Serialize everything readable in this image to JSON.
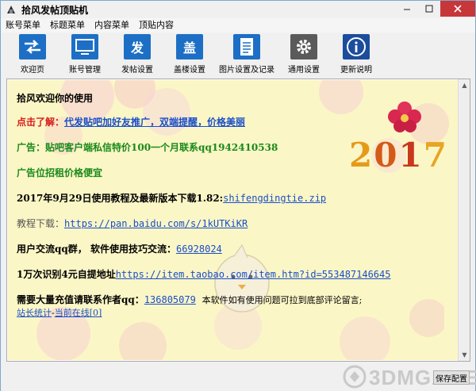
{
  "window": {
    "title": "拾风发帖顶贴机"
  },
  "menubar": {
    "items": [
      "账号菜单",
      "标题菜单",
      "内容菜单",
      "顶贴内容"
    ]
  },
  "toolbar": {
    "items": [
      {
        "label": "欢迎页",
        "icon": "arrows-icon",
        "glyph": "⇆",
        "color": "#1c6fc5"
      },
      {
        "label": "账号管理",
        "icon": "monitor-icon",
        "glyph": "",
        "color": "#1c6fc5"
      },
      {
        "label": "发帖设置",
        "icon": "fa-char-icon",
        "glyph": "发",
        "color": "#1c6fc5"
      },
      {
        "label": "盖楼设置",
        "icon": "gai-char-icon",
        "glyph": "盖",
        "color": "#1c6fc5"
      },
      {
        "label": "图片设置及记录",
        "icon": "document-icon",
        "glyph": "",
        "color": "#1c6fc5"
      },
      {
        "label": "通用设置",
        "icon": "gear-icon",
        "glyph": "⚙",
        "color": "#5a5a5a"
      },
      {
        "label": "更新说明",
        "icon": "info-icon",
        "glyph": "i",
        "color": "#1c4c9c"
      }
    ]
  },
  "content": {
    "welcome": "拾风欢迎你的使用",
    "promo_prefix": "点击了解：",
    "promo_link": "代发贴吧加好友推广，双端提醒，价格美丽",
    "ad1": "广告：贴吧客户端私信特价100一个月联系qq1942410538",
    "ad2": "广告位招租价格便宜",
    "update_text": "2017年9月29日使用教程及最新版本下载1.82:",
    "update_link": "shifengdingtie.zip",
    "tutorial_label": "教程下载：",
    "tutorial_link": "https://pan.baidu.com/s/1kUTKiKR",
    "group_text": "用户交流qq群， 软件使用技巧交流：",
    "group_link": "66928024",
    "captcha_text": "1万次识别4元自提地址",
    "captcha_link": "https://item.taobao.com/item.htm?id=553487146645",
    "recharge_text": "需要大量充值请联系作者qq：",
    "recharge_link": "136805079",
    "recharge_note": "本软件如有使用问题可拉到底部评论留言;",
    "stats_link": "站长统计",
    "online_sep": "-",
    "online_link": "当前在线[0]",
    "year_2": "2",
    "year_0": "0",
    "year_1": "1",
    "year_7": "7"
  },
  "footer": {
    "save_label": "保存配置"
  },
  "watermark": "3DMGAME",
  "colors": {
    "content_bg": "#fbf6c6",
    "green_text": "#1a8a1a",
    "red_text": "#d81b1b",
    "link": "#1a4fc9",
    "close_button": "#c7373a"
  }
}
